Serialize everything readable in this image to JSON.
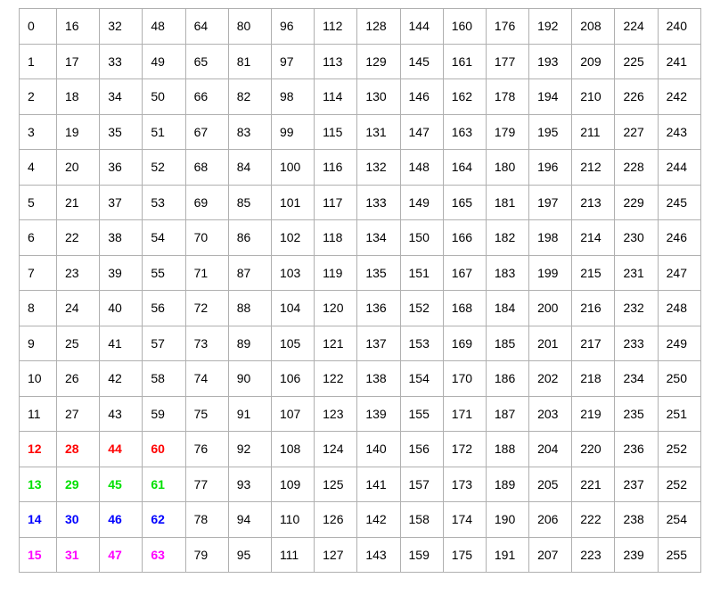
{
  "table": {
    "rows": [
      {
        "cells": [
          "0",
          "16",
          "32",
          "48",
          "64",
          "80",
          "96",
          "112",
          "128",
          "144",
          "160",
          "176",
          "192",
          "208",
          "224",
          "240"
        ]
      },
      {
        "cells": [
          "1",
          "17",
          "33",
          "49",
          "65",
          "81",
          "97",
          "113",
          "129",
          "145",
          "161",
          "177",
          "193",
          "209",
          "225",
          "241"
        ]
      },
      {
        "cells": [
          "2",
          "18",
          "34",
          "50",
          "66",
          "82",
          "98",
          "114",
          "130",
          "146",
          "162",
          "178",
          "194",
          "210",
          "226",
          "242"
        ]
      },
      {
        "cells": [
          "3",
          "19",
          "35",
          "51",
          "67",
          "83",
          "99",
          "115",
          "131",
          "147",
          "163",
          "179",
          "195",
          "211",
          "227",
          "243"
        ]
      },
      {
        "cells": [
          "4",
          "20",
          "36",
          "52",
          "68",
          "84",
          "100",
          "116",
          "132",
          "148",
          "164",
          "180",
          "196",
          "212",
          "228",
          "244"
        ]
      },
      {
        "cells": [
          "5",
          "21",
          "37",
          "53",
          "69",
          "85",
          "101",
          "117",
          "133",
          "149",
          "165",
          "181",
          "197",
          "213",
          "229",
          "245"
        ]
      },
      {
        "cells": [
          "6",
          "22",
          "38",
          "54",
          "70",
          "86",
          "102",
          "118",
          "134",
          "150",
          "166",
          "182",
          "198",
          "214",
          "230",
          "246"
        ]
      },
      {
        "cells": [
          "7",
          "23",
          "39",
          "55",
          "71",
          "87",
          "103",
          "119",
          "135",
          "151",
          "167",
          "183",
          "199",
          "215",
          "231",
          "247"
        ]
      },
      {
        "cells": [
          "8",
          "24",
          "40",
          "56",
          "72",
          "88",
          "104",
          "120",
          "136",
          "152",
          "168",
          "184",
          "200",
          "216",
          "232",
          "248"
        ]
      },
      {
        "cells": [
          "9",
          "25",
          "41",
          "57",
          "73",
          "89",
          "105",
          "121",
          "137",
          "153",
          "169",
          "185",
          "201",
          "217",
          "233",
          "249"
        ]
      },
      {
        "cells": [
          "10",
          "26",
          "42",
          "58",
          "74",
          "90",
          "106",
          "122",
          "138",
          "154",
          "170",
          "186",
          "202",
          "218",
          "234",
          "250"
        ]
      },
      {
        "cells": [
          "11",
          "27",
          "43",
          "59",
          "75",
          "91",
          "107",
          "123",
          "139",
          "155",
          "171",
          "187",
          "203",
          "219",
          "235",
          "251"
        ]
      },
      {
        "cells": [
          "12",
          "28",
          "44",
          "60",
          "76",
          "92",
          "108",
          "124",
          "140",
          "156",
          "172",
          "188",
          "204",
          "220",
          "236",
          "252"
        ],
        "highlight_color": "#ff0000",
        "highlight_count": 4
      },
      {
        "cells": [
          "13",
          "29",
          "45",
          "61",
          "77",
          "93",
          "109",
          "125",
          "141",
          "157",
          "173",
          "189",
          "205",
          "221",
          "237",
          "252"
        ],
        "highlight_color": "#00e000",
        "highlight_count": 4
      },
      {
        "cells": [
          "14",
          "30",
          "46",
          "62",
          "78",
          "94",
          "110",
          "126",
          "142",
          "158",
          "174",
          "190",
          "206",
          "222",
          "238",
          "254"
        ],
        "highlight_color": "#0000ff",
        "highlight_count": 4
      },
      {
        "cells": [
          "15",
          "31",
          "47",
          "63",
          "79",
          "95",
          "111",
          "127",
          "143",
          "159",
          "175",
          "191",
          "207",
          "223",
          "239",
          "255"
        ],
        "highlight_color": "#ff00ff",
        "highlight_count": 4
      }
    ]
  }
}
